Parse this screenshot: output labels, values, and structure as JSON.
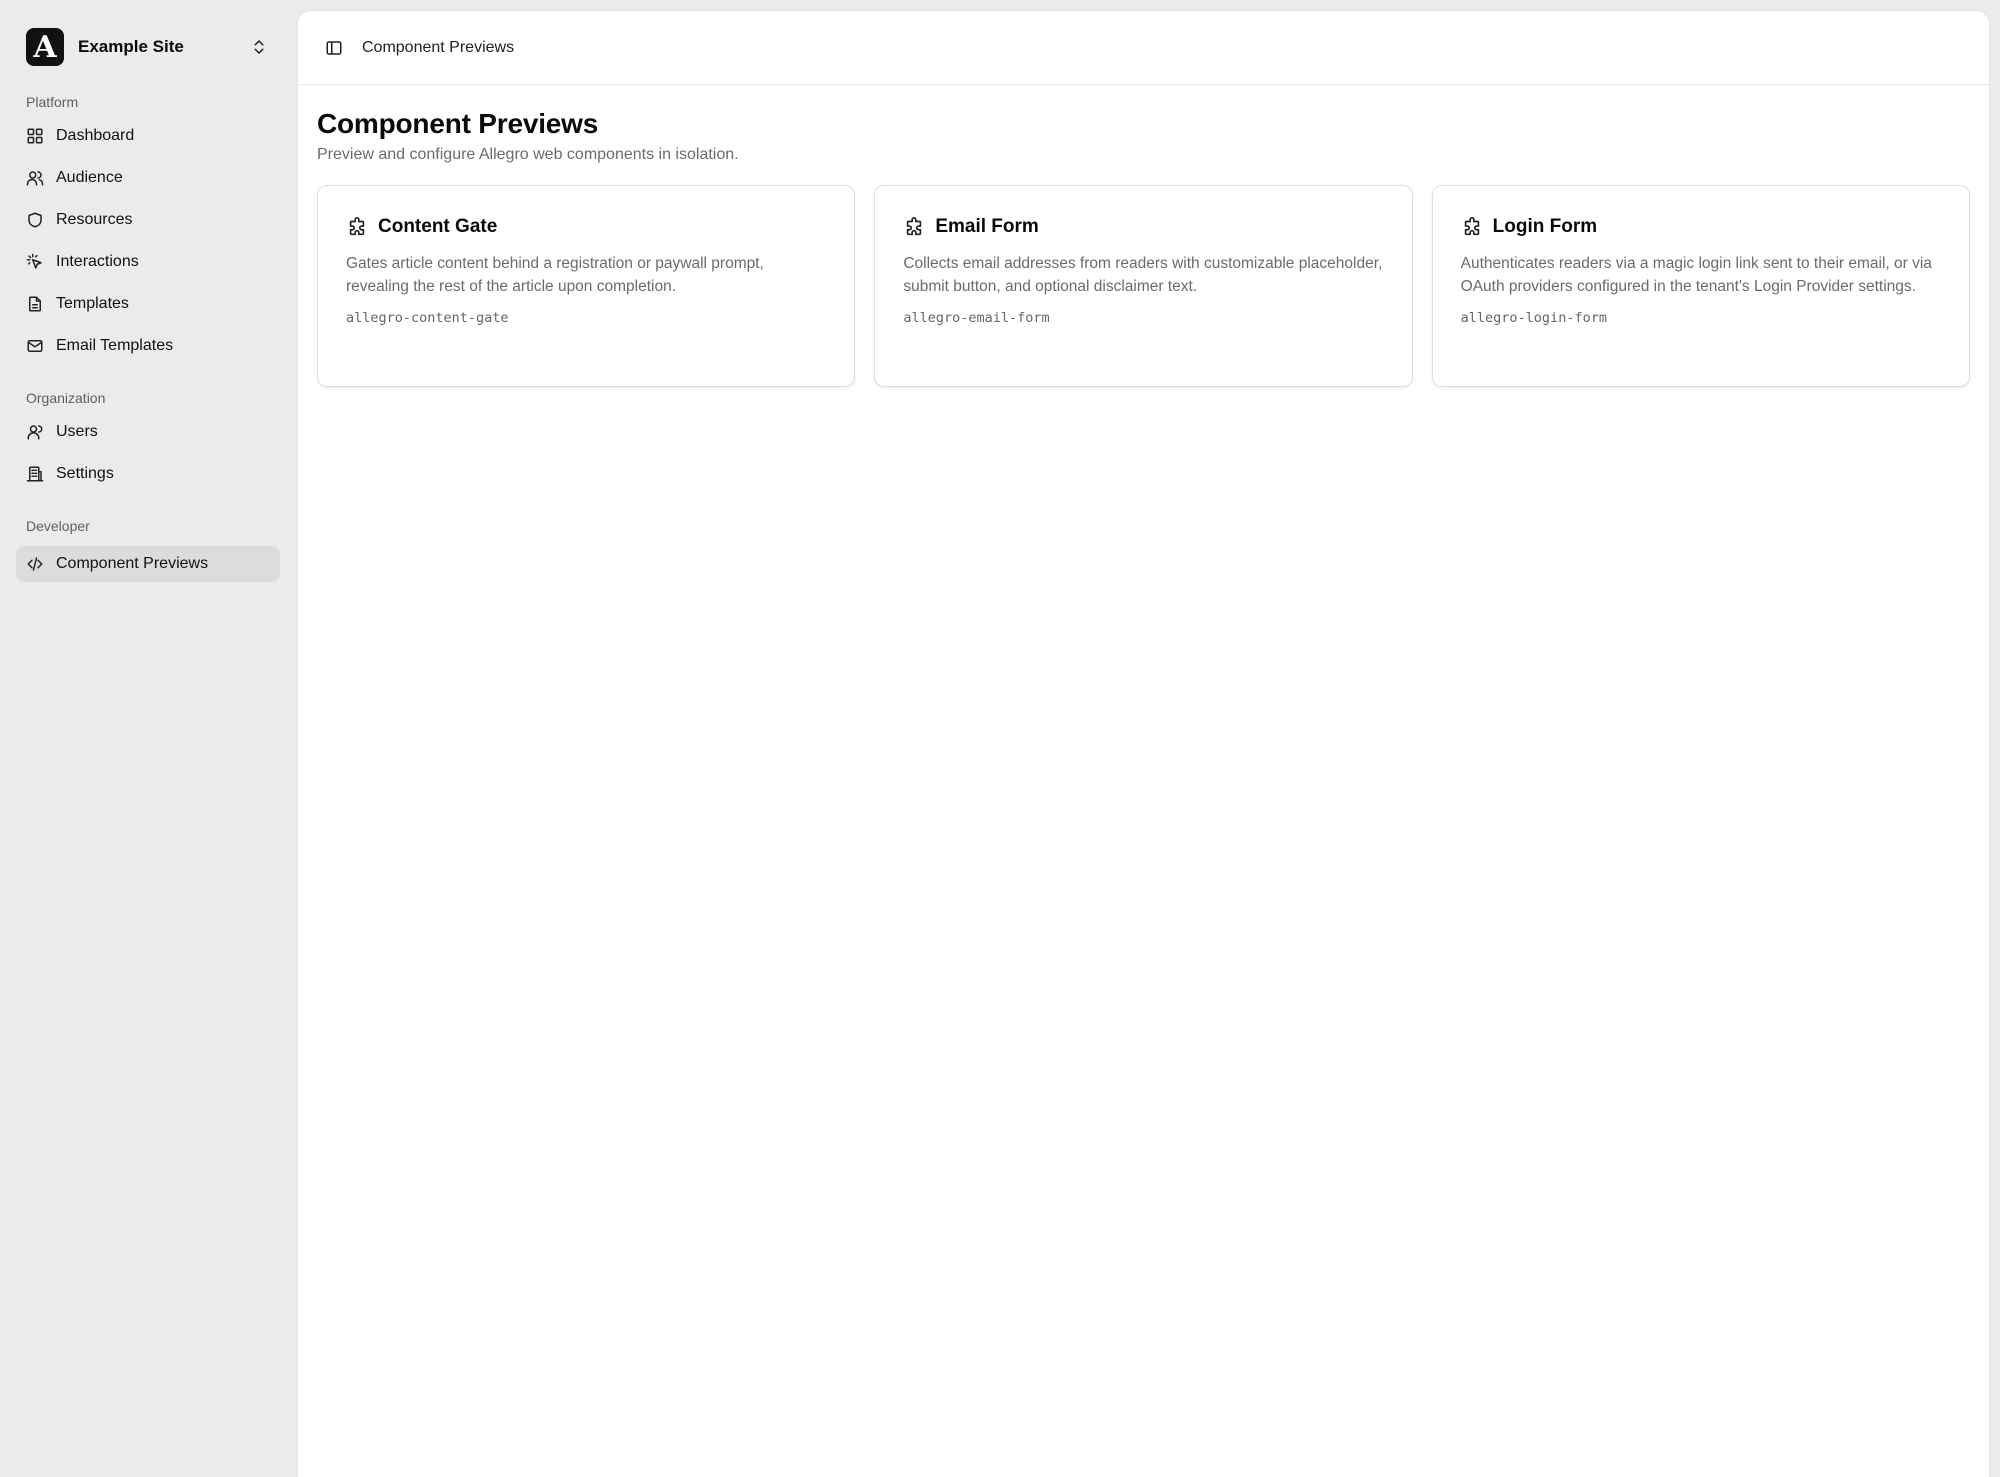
{
  "site": {
    "name": "Example Site",
    "logo_letter": "A"
  },
  "sidebar": {
    "groups": [
      {
        "label": "Platform",
        "items": [
          {
            "label": "Dashboard",
            "icon": "dashboard-grid-icon"
          },
          {
            "label": "Audience",
            "icon": "users-icon"
          },
          {
            "label": "Resources",
            "icon": "shield-icon"
          },
          {
            "label": "Interactions",
            "icon": "sparkle-click-icon"
          },
          {
            "label": "Templates",
            "icon": "document-icon"
          },
          {
            "label": "Email Templates",
            "icon": "mail-icon"
          }
        ]
      },
      {
        "label": "Organization",
        "items": [
          {
            "label": "Users",
            "icon": "user-icon"
          },
          {
            "label": "Settings",
            "icon": "building-icon"
          }
        ]
      },
      {
        "label": "Developer",
        "items": [
          {
            "label": "Component Previews",
            "icon": "code-icon",
            "active": true
          }
        ]
      }
    ]
  },
  "header": {
    "breadcrumb": "Component Previews"
  },
  "page": {
    "title": "Component Previews",
    "description": "Preview and configure Allegro web components in isolation."
  },
  "cards": [
    {
      "title": "Content Gate",
      "description": "Gates article content behind a registration or paywall prompt, revealing the rest of the article upon completion.",
      "tag": "allegro-content-gate",
      "icon": "puzzle-icon"
    },
    {
      "title": "Email Form",
      "description": "Collects email addresses from readers with customizable placeholder, submit button, and optional disclaimer text.",
      "tag": "allegro-email-form",
      "icon": "puzzle-icon"
    },
    {
      "title": "Login Form",
      "description": "Authenticates readers via a magic login link sent to their email, or via OAuth providers configured in the tenant's Login Provider settings.",
      "tag": "allegro-login-form",
      "icon": "puzzle-icon"
    }
  ],
  "colors": {
    "sidebar_bg": "#ebebeb",
    "active_item_bg": "#dcdcdc",
    "main_bg": "#ffffff",
    "muted_text": "#6b6b6b"
  }
}
